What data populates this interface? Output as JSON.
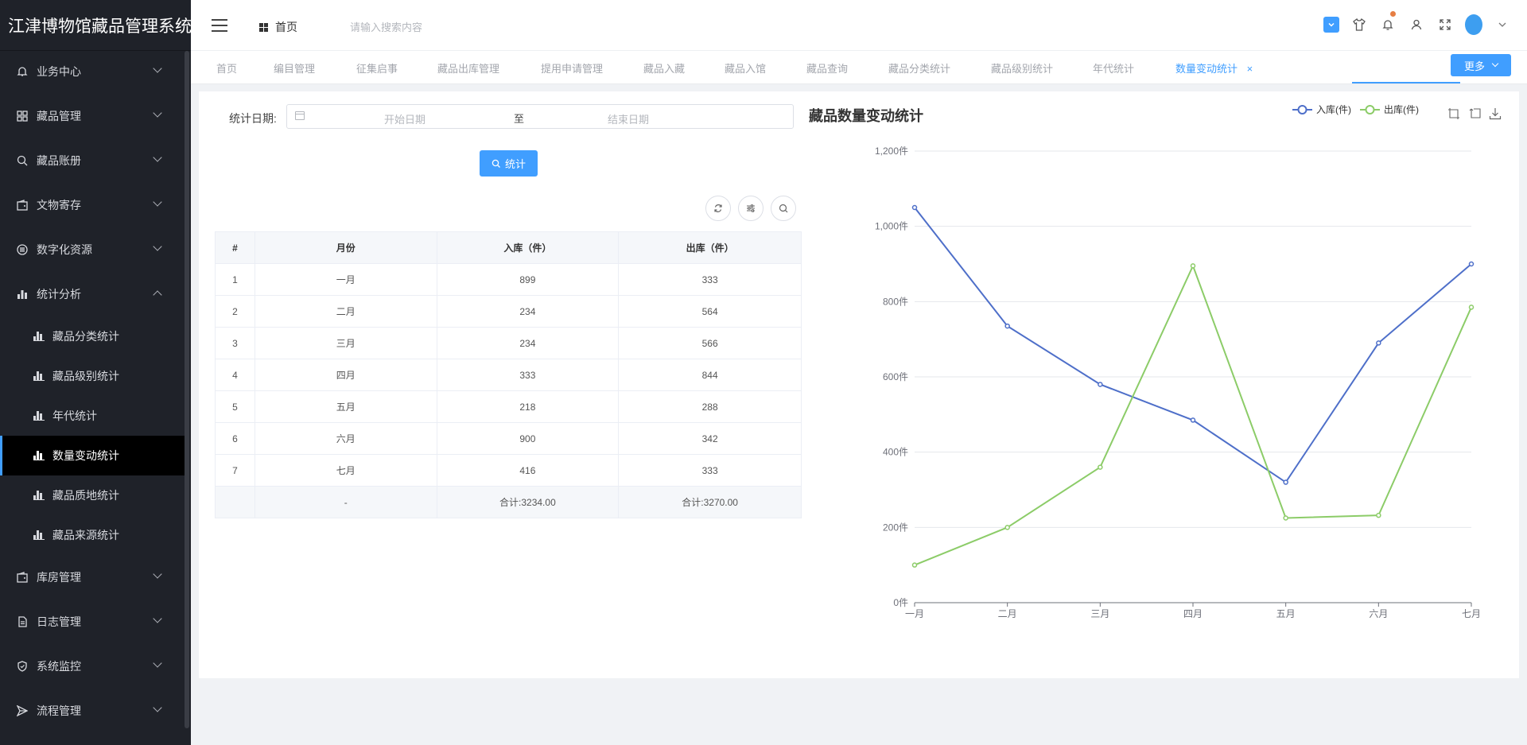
{
  "app": {
    "title": "江津博物馆藏品管理系统"
  },
  "sidebar": {
    "items": [
      {
        "label": "业务中心",
        "icon": "bell-icon"
      },
      {
        "label": "藏品管理",
        "icon": "grid-icon"
      },
      {
        "label": "藏品账册",
        "icon": "search-icon"
      },
      {
        "label": "文物寄存",
        "icon": "wallet-icon"
      },
      {
        "label": "数字化资源",
        "icon": "list-icon"
      },
      {
        "label": "统计分析",
        "icon": "bar-chart-icon"
      },
      {
        "label": "库房管理",
        "icon": "wallet-icon"
      },
      {
        "label": "日志管理",
        "icon": "document-icon"
      },
      {
        "label": "系统监控",
        "icon": "shield-icon"
      },
      {
        "label": "流程管理",
        "icon": "send-icon"
      }
    ],
    "sub_items": [
      {
        "label": "藏品分类统计"
      },
      {
        "label": "藏品级别统计"
      },
      {
        "label": "年代统计"
      },
      {
        "label": "数量变动统计"
      },
      {
        "label": "藏品质地统计"
      },
      {
        "label": "藏品来源统计"
      }
    ]
  },
  "header": {
    "home_label": "首页",
    "search_placeholder": "请输入搜索内容"
  },
  "tabs": {
    "items": [
      {
        "label": "首页"
      },
      {
        "label": "编目管理"
      },
      {
        "label": "征集启事"
      },
      {
        "label": "藏品出库管理"
      },
      {
        "label": "提用申请管理"
      },
      {
        "label": "藏品入藏"
      },
      {
        "label": "藏品入馆"
      },
      {
        "label": "藏品查询"
      },
      {
        "label": "藏品分类统计"
      },
      {
        "label": "藏品级别统计"
      },
      {
        "label": "年代统计"
      },
      {
        "label": "数量变动统计"
      }
    ],
    "close_glyph": "×",
    "more_label": "更多"
  },
  "filter": {
    "date_label": "统计日期:",
    "start_placeholder": "开始日期",
    "separator": "至",
    "end_placeholder": "结束日期",
    "stat_button": "统计"
  },
  "table": {
    "headers": [
      "#",
      "月份",
      "入库（件）",
      "出库（件）"
    ],
    "rows": [
      [
        "1",
        "一月",
        "899",
        "333"
      ],
      [
        "2",
        "二月",
        "234",
        "564"
      ],
      [
        "3",
        "三月",
        "234",
        "566"
      ],
      [
        "4",
        "四月",
        "333",
        "844"
      ],
      [
        "5",
        "五月",
        "218",
        "288"
      ],
      [
        "6",
        "六月",
        "900",
        "342"
      ],
      [
        "7",
        "七月",
        "416",
        "333"
      ]
    ],
    "summary": [
      "",
      "-",
      "合计:3234.00",
      "合计:3270.00"
    ]
  },
  "colors": {
    "accent": "#409eff",
    "series_in": "#4e6fc9",
    "series_out": "#8ccc68",
    "sidebar_bg": "#1f2229"
  },
  "chart_data": {
    "type": "line",
    "title": "藏品数量变动统计",
    "categories": [
      "一月",
      "二月",
      "三月",
      "四月",
      "五月",
      "六月",
      "七月"
    ],
    "series": [
      {
        "name": "入库(件)",
        "values": [
          1050,
          735,
          580,
          485,
          320,
          690,
          900
        ]
      },
      {
        "name": "出库(件)",
        "values": [
          100,
          200,
          360,
          895,
          225,
          232,
          785
        ]
      }
    ],
    "y_ticks": [
      "0件",
      "200件",
      "400件",
      "600件",
      "800件",
      "1,000件",
      "1,200件"
    ],
    "ylim": [
      0,
      1200
    ],
    "grid": true,
    "legend": "top-center"
  }
}
